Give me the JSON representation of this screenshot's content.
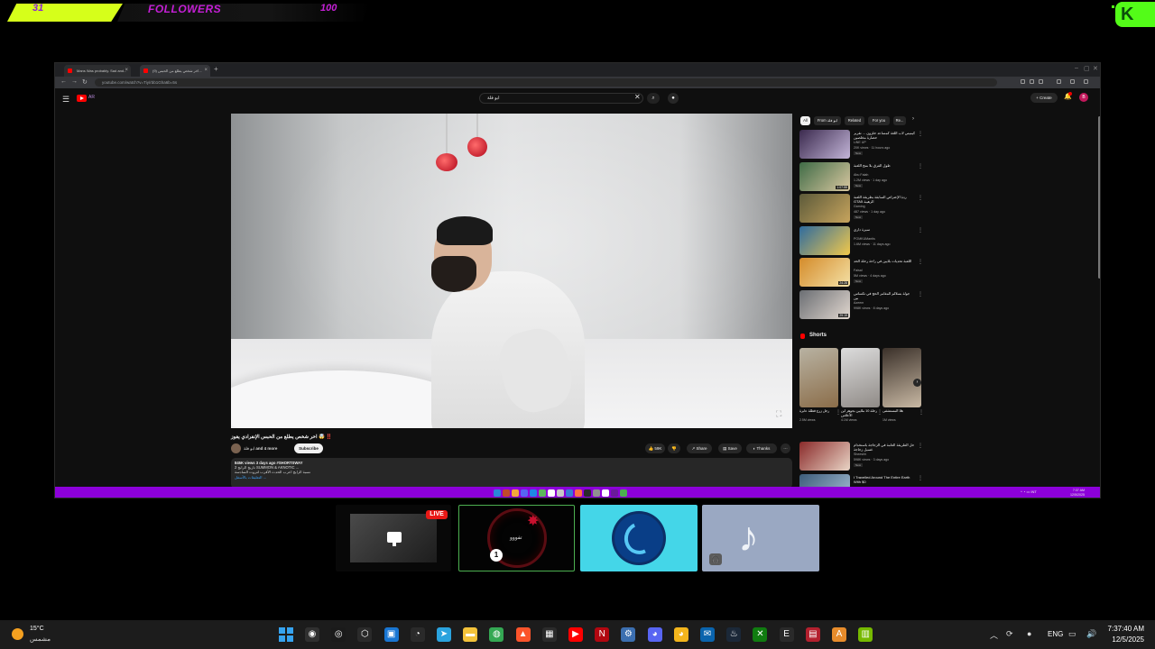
{
  "overlay": {
    "follower_count": "31",
    "label": "FOLLOWERS",
    "goal": "100",
    "kick_logo": "K"
  },
  "browser": {
    "tabs": [
      {
        "title": "Mans Was probably. Sad and..."
      },
      {
        "title": "(9) اخر شخص يطلع من الحبس..."
      }
    ],
    "new_tab": "+",
    "url": "youtube.com/watch?v=Tiy/rbb1Gha6b=5s",
    "window_controls": [
      "–",
      "▢",
      "✕"
    ]
  },
  "youtube": {
    "menu_glyph": "☰",
    "logo_suffix": "AR",
    "search_query": "ابو فلة",
    "clear_glyph": "✕",
    "search_glyph": "⌕",
    "mic_glyph": "●",
    "create_label": "+ Create",
    "bell_glyph": "♪",
    "avatar_letter": "B",
    "video": {
      "title": "‼️ 🤯 اخر شخص يطلع من الحبس الإنفرادي يفوز",
      "channel": "ابو فلة",
      "channel_suffix": "and 4 more",
      "subscribe_label": "Subscribe",
      "likes": "👍 59K",
      "dislike": "👎",
      "share": "↗ Share",
      "save": "▤ Save",
      "thanks": "◐ Thanks",
      "more": "⋯",
      "mini_icon": "⛶",
      "description": {
        "meta": "845K views  3 days ago  #SHORTSWAY",
        "line1": "2 تاريخ الرابح SUMMON & AKNOTIC ...",
        "line2": "نسبة الرابح اعرب الحدث الأقرب لثروت السادسة",
        "line3": "التعليقات بالأسفل  ..."
      }
    },
    "chips": [
      {
        "label": "All",
        "active": true
      },
      {
        "label": "From ابو فلة",
        "active": false
      },
      {
        "label": "Related",
        "active": false
      },
      {
        "label": "For you",
        "active": false
      },
      {
        "label": "Re...",
        "active": false
      }
    ],
    "chip_next": "›",
    "recommendations": [
      {
        "title": "كيميتي لاب اللغة كمساعد حلزون ... تقرير حضارة مخلصين",
        "channel": "LiNE UP",
        "views": "20K views · 11 hours ago",
        "badge": "New",
        "duration": "",
        "color1": "#3b2a4e",
        "color2": "#c3b5d8"
      },
      {
        "title": "طول الفرق بلا منح اللعبة",
        "channel": "Abu Falah",
        "views": "1.2M views · 1 day ago",
        "badge": "New",
        "duration": "1:07:55",
        "color1": "#3f6b46",
        "color2": "#d9c7a0"
      },
      {
        "title": "ردة الإعتراض السابقة بطريقة اللعبة الرهيبة GTA5",
        "channel": "Gaming",
        "views": "487 views · 1 day ago",
        "badge": "New",
        "duration": "",
        "color1": "#5c5a3a",
        "color2": "#c7a45d"
      },
      {
        "title": "سيرة داري",
        "channel": "POMKUMantis",
        "views": "1.6M views · 11 days ago",
        "badge": "",
        "duration": "",
        "color1": "#2e6b9e",
        "color2": "#f1c84b"
      },
      {
        "title": "اللعبة تحديات بلايين في راحة رحلة الحد",
        "channel": "Faisal",
        "views": "5M views · 4 days ago",
        "badge": "New",
        "duration": "24:28",
        "color1": "#d48b2a",
        "color2": "#f4e1a6"
      },
      {
        "title": "جولة بسلالم المغامر الحج في تكساس بين",
        "channel": "Azeem",
        "views": "998K views · 8 days ago",
        "badge": "",
        "duration": "29:19",
        "color1": "#6b6e73",
        "color2": "#e1d7cf"
      }
    ],
    "shorts_label": "Shorts",
    "shorts": [
      {
        "title": "رجل زرع فطلة عابرة",
        "views": "2.5M views",
        "color1": "#b8b2a2",
        "color2": "#8b6d49"
      },
      {
        "title": "رحلة 10 ملايين بجوهر ابن الأعلاس",
        "views": "4.1M views",
        "color1": "#dcdcdc",
        "color2": "#8f8a86"
      },
      {
        "title": "هلا المستشفى",
        "views": "1M views",
        "color1": "#3a3029",
        "color2": "#c9b9a4"
      }
    ],
    "short_next": "›",
    "extra_recommendations": [
      {
        "title": "حل الطريقة العامة في الزجاجة باستخدام غسيل زجاجة",
        "channel": "Sheeshh",
        "views": "598K views · 3 days ago",
        "badge": "New",
        "duration": "",
        "color1": "#8a2a2a",
        "color2": "#e9d5c6"
      },
      {
        "title": "I Travelled Around The Entire Earth With $0",
        "channel": "",
        "views": "",
        "badge": "",
        "duration": "",
        "color1": "#3d5c7a",
        "color2": "#a7c1d6"
      }
    ]
  },
  "inner_taskbar": {
    "tray_text": "^   ◔   ▭   INT",
    "time": "7:37 AM",
    "date": "12/5/2025",
    "icon_colors": [
      "#2b88d8",
      "#c04a2b",
      "#f2a93b",
      "#5765f2",
      "#1e88e5",
      "#5cb85c",
      "#ffffff",
      "#c7c7c7",
      "#3a7bd5",
      "#ff7043",
      "#2b2b2b",
      "#909090",
      "#ffffff",
      "#6a1b9a",
      "#4caf50"
    ]
  },
  "scenes": {
    "live_label": "LIVE",
    "scene2_text": "تفووو",
    "scene2_badge": "1",
    "scene4_note": "♪",
    "scene4_badge": "🎧"
  },
  "taskbar": {
    "temperature": "15°C",
    "condition": "مشمس",
    "language": "ENG",
    "time": "7:37:40 AM",
    "date": "12/5/2025",
    "tray_up": "︿",
    "apps": [
      {
        "name": "app-obs",
        "color": "#303030",
        "glyph": "◉"
      },
      {
        "name": "app-chrome-canary",
        "color": "#1a1a1a",
        "glyph": "◎"
      },
      {
        "name": "app-cube",
        "color": "#2a2a2a",
        "glyph": "⬡"
      },
      {
        "name": "app-window",
        "color": "#1976d2",
        "glyph": "▣"
      },
      {
        "name": "app-speedometer",
        "color": "#2a2a2a",
        "glyph": "◔"
      },
      {
        "name": "app-telegram",
        "color": "#2aa3de",
        "glyph": "➤"
      },
      {
        "name": "app-file-explorer",
        "color": "#f3c23a",
        "glyph": "▬"
      },
      {
        "name": "app-chrome",
        "color": "#34a853",
        "glyph": "◍"
      },
      {
        "name": "app-brave",
        "color": "#fb542b",
        "glyph": "▲"
      },
      {
        "name": "app-store",
        "color": "#2b2b2b",
        "glyph": "▦"
      },
      {
        "name": "app-youtube-music",
        "color": "#ff0000",
        "glyph": "▶"
      },
      {
        "name": "app-netflix",
        "color": "#b20710",
        "glyph": "N"
      },
      {
        "name": "app-settings",
        "color": "#3c6fb0",
        "glyph": "⚙"
      },
      {
        "name": "app-discord",
        "color": "#5865f2",
        "glyph": "◕"
      },
      {
        "name": "app-discord-ptb",
        "color": "#f3b51c",
        "glyph": "◕"
      },
      {
        "name": "app-outlook",
        "color": "#0a64ad",
        "glyph": "✉"
      },
      {
        "name": "app-steam",
        "color": "#1b2838",
        "glyph": "♨"
      },
      {
        "name": "app-xbox",
        "color": "#107c10",
        "glyph": "✕"
      },
      {
        "name": "app-epic",
        "color": "#2a2a2a",
        "glyph": "E"
      },
      {
        "name": "app-voicemeeter",
        "color": "#b3202e",
        "glyph": "▤"
      },
      {
        "name": "app-adobe",
        "color": "#e88c2b",
        "glyph": "A"
      },
      {
        "name": "app-nvidia",
        "color": "#76b900",
        "glyph": "▥"
      }
    ],
    "tray_icons": [
      "⟳",
      "●",
      "✎",
      "▭",
      "◫",
      "🔊"
    ]
  }
}
